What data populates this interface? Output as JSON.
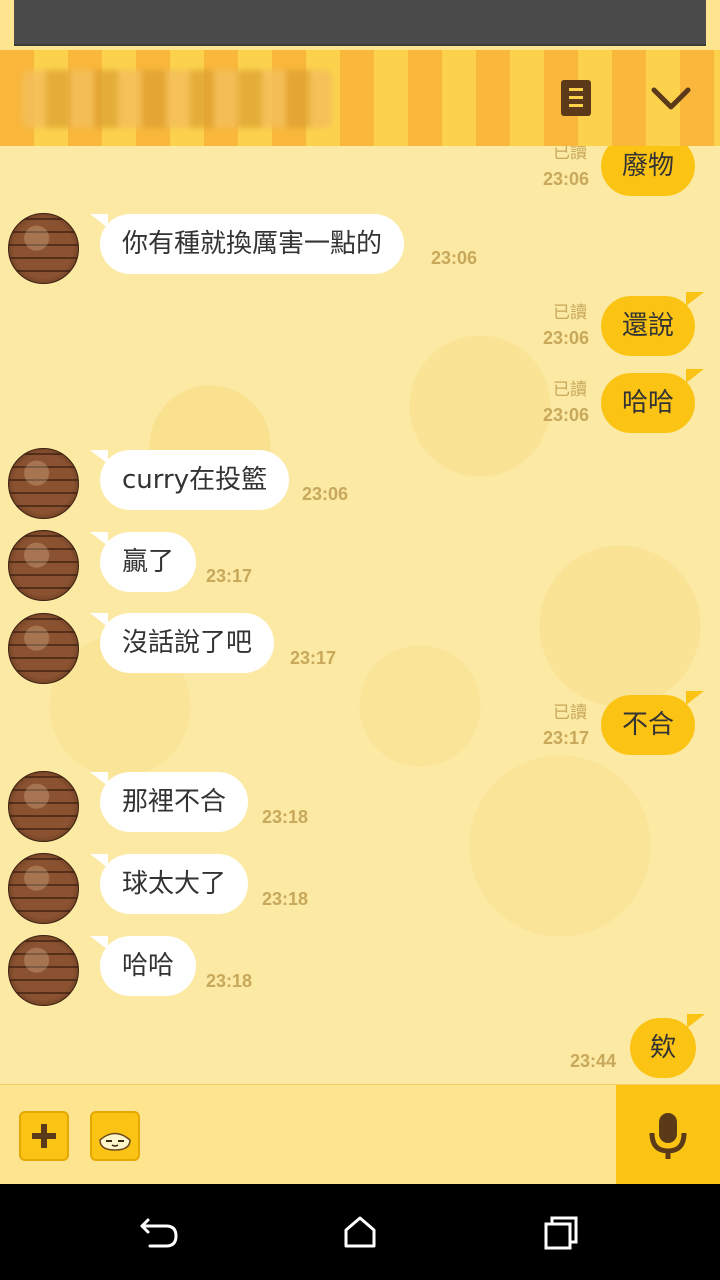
{
  "colors": {
    "accent": "#fbc415",
    "background": "#fbe9a4",
    "header": "#fcd24d",
    "text": "#333333",
    "meta": "#c8a85a"
  },
  "header": {
    "notes_icon": "notes-icon",
    "collapse_icon": "chevron-down-icon"
  },
  "messages": [
    {
      "dir": "out",
      "text": "廢物",
      "time": "23:06",
      "read": "已讀"
    },
    {
      "dir": "in",
      "text": "你有種就換厲害一點的",
      "time": "23:06"
    },
    {
      "dir": "out",
      "text": "還說",
      "time": "23:06",
      "read": "已讀"
    },
    {
      "dir": "out",
      "text": "哈哈",
      "time": "23:06",
      "read": "已讀"
    },
    {
      "dir": "in",
      "text": "curry在投籃",
      "time": "23:06"
    },
    {
      "dir": "in",
      "text": "贏了",
      "time": "23:17"
    },
    {
      "dir": "in",
      "text": "沒話說了吧",
      "time": "23:17"
    },
    {
      "dir": "out",
      "text": "不合",
      "time": "23:17",
      "read": "已讀"
    },
    {
      "dir": "in",
      "text": "那裡不合",
      "time": "23:18"
    },
    {
      "dir": "in",
      "text": "球太大了",
      "time": "23:18"
    },
    {
      "dir": "in",
      "text": "哈哈",
      "time": "23:18"
    },
    {
      "dir": "out",
      "text": "欸",
      "time": "23:44"
    }
  ],
  "input_bar": {
    "plus_icon": "plus-icon",
    "sticker_icon": "sticker-icon",
    "mic_icon": "microphone-icon"
  },
  "nav": {
    "back_icon": "back-icon",
    "home_icon": "home-icon",
    "recents_icon": "recents-icon"
  }
}
